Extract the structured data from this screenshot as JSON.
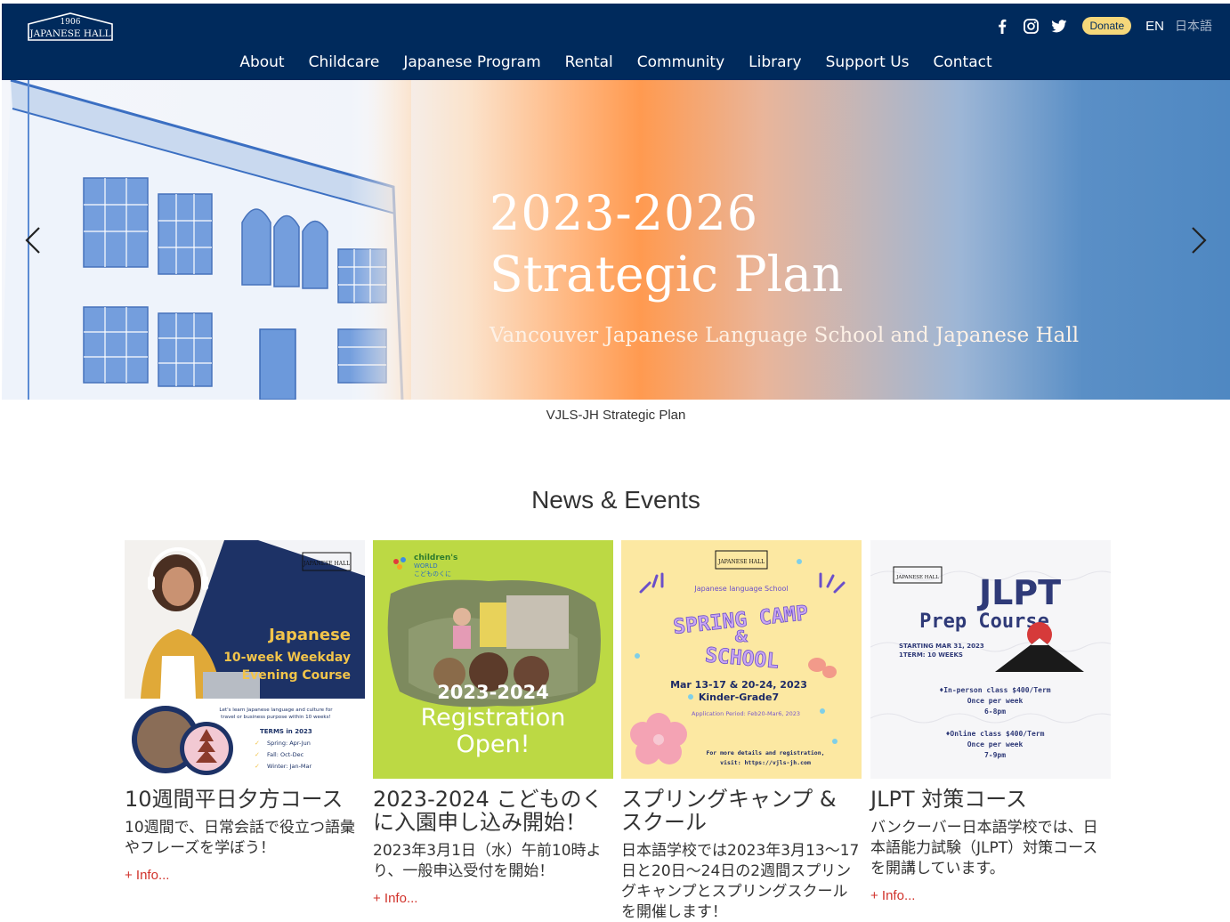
{
  "header": {
    "logo_year": "1906",
    "logo_text": "JAPANESE HALL",
    "donate_label": "Donate",
    "lang_en": "EN",
    "lang_ja": "日本語",
    "social_icons": [
      "facebook-icon",
      "instagram-icon",
      "twitter-icon"
    ]
  },
  "nav": {
    "items": [
      "About",
      "Childcare",
      "Japanese Program",
      "Rental",
      "Community",
      "Library",
      "Support Us",
      "Contact"
    ]
  },
  "hero": {
    "title_line1": "2023-2026",
    "title_line2": "Strategic Plan",
    "subtitle": "Vancouver Japanese Language School and Japanese Hall",
    "caption": "VJLS-JH Strategic Plan"
  },
  "news": {
    "section_title": "News & Events",
    "cards": [
      {
        "title": "10週間平日夕方コース",
        "desc": "10週間で、日常会話で役立つ語彙やフレーズを学ぼう！",
        "more": "+ Info...",
        "img": {
          "heading1": "Japanese",
          "heading2": "10-week Weekday",
          "heading3": "Evening Course",
          "blurb": "Let's learn Japanese language and culture for travel or business purpose within 10 weeks!",
          "terms_title": "TERMS in 2023",
          "terms": [
            "Spring: Apr-Jun",
            "Fall: Oct-Dec",
            "Winter: Jan-Mar"
          ]
        }
      },
      {
        "title": "2023-2024 こどものくに入園申し込み開始！",
        "desc": "2023年3月1日（水）午前10時より、一般申込受付を開始！",
        "more": "+ Info...",
        "img": {
          "brand1": "children's",
          "brand2": "WORLD",
          "brand3": "こどものくに",
          "year": "2023-2024",
          "line1": "Registration",
          "line2": "Open!"
        }
      },
      {
        "title": "スプリングキャンプ & スクール",
        "desc": "日本語学校では2023年3月13〜17日と20日〜24日の2週間スプリングキャンプとスプリングスクールを開催します！",
        "more": "",
        "img": {
          "school": "Japanese language School",
          "line1": "SPRING CAMP",
          "amp": "&",
          "line2": "SCHOOL",
          "dates": "Mar 13-17 & 20-24, 2023",
          "grades": "Kinder-Grade7",
          "period": "Application Period: Feb20-Mar6, 2023",
          "details": "For more details and registration,",
          "visit": "visit: https://vjls-jh.com"
        }
      },
      {
        "title": "JLPT 対策コース",
        "desc": "バンクーバー日本語学校では、日本語能力試験（JLPT）対策コースを開講しています。",
        "more": "+ Info...",
        "img": {
          "title1": "JLPT",
          "title2": "Prep Course",
          "start1": "STARTING MAR 31, 2023",
          "start2": "1TERM: 10 WEEKS",
          "inperson": "♦In-person class   $400/Term",
          "inperson2": "Once per week",
          "inperson3": "6-8pm",
          "online": "♦Online class $400/Term",
          "online2": "Once per week",
          "online3": "7-9pm"
        }
      }
    ]
  }
}
